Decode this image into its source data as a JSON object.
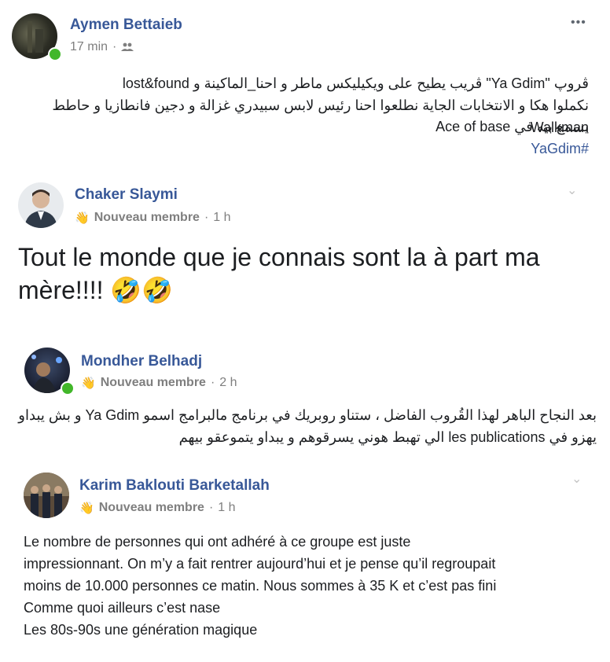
{
  "post1": {
    "author": "Aymen Bettaieb",
    "time": "17 min",
    "separator": "·",
    "privacy_icon": "group-icon",
    "more": "•••",
    "lines": [
      "ڨروپ \"Ya Gdim\" ڨريب يطيح على ويكيليكس ماطر و احنا_الماكينة و lost&found",
      "نكملوا هكا و الانتخابات الجاية نطلعوا احنا رئيس لابس سبيدري غزالة و دجين فانطازيا و حاطط Walkman",
      "يسمع بيه في Ace of base"
    ],
    "hashtag": "#YaGdim"
  },
  "comment1": {
    "author": "Chaker Slaymi",
    "badge": "Nouveau membre",
    "badge_icon": "wave-hand-icon",
    "separator": "·",
    "time": "1 h",
    "text": "Tout le monde que je connais sont la à part ma mère!!!!",
    "emoji": "🤣🤣"
  },
  "comment2": {
    "author": "Mondher Belhadj",
    "badge": "Nouveau membre",
    "separator": "·",
    "time": "2 h",
    "lines": [
      "بعد النجاح الباهر لهذا القُروب الفاضل ، ستناو روبريك في برنامج مالبرامج اسمو Ya Gdim و بش يبداو",
      "يهزو في les publications الي تهبط هوني يسرقوهم و يبداو يتموعقو بيهم"
    ]
  },
  "comment3": {
    "author": "Karim Baklouti Barketallah",
    "badge": "Nouveau membre",
    "separator": "·",
    "time": "1 h",
    "lines": [
      "Le nombre de personnes qui ont adhéré à ce groupe est juste",
      "impressionnant. On m’y a fait rentrer aujourd’hui et je pense qu’il regroupait",
      "moins de 10.000 personnes ce matin. Nous sommes à 35 K et c’est pas fini",
      "Comme quoi ailleurs c’est nase",
      "Les 80s-90s une génération magique"
    ]
  },
  "colors": {
    "link": "#385898",
    "meta": "#7f7f7f",
    "online": "#42b72a"
  }
}
